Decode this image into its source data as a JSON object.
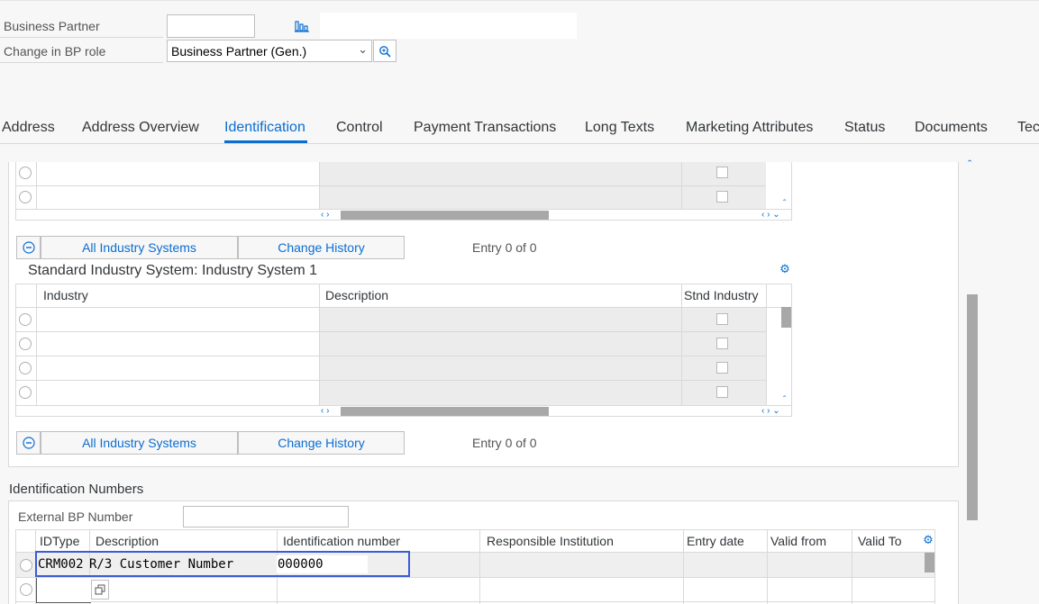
{
  "header": {
    "bp_label": "Business Partner",
    "bp_value": "",
    "bp_desc": "",
    "role_label": "Change in BP role",
    "role_value": "Business Partner (Gen.)"
  },
  "tabs": [
    {
      "label": "Address"
    },
    {
      "label": "Address Overview"
    },
    {
      "label": "Identification"
    },
    {
      "label": "Control"
    },
    {
      "label": "Payment Transactions"
    },
    {
      "label": "Long Texts"
    },
    {
      "label": "Marketing Attributes"
    },
    {
      "label": "Status"
    },
    {
      "label": "Documents"
    },
    {
      "label": "Tec"
    }
  ],
  "toolbar1": {
    "all_industry": "All Industry Systems",
    "change_history": "Change History",
    "entry": "Entry 0 of 0"
  },
  "industry_table": {
    "title": "Standard Industry System: Industry System 1",
    "columns": [
      "Industry",
      "Description",
      "Stnd Industry"
    ]
  },
  "toolbar2": {
    "all_industry": "All Industry Systems",
    "change_history": "Change History",
    "entry": "Entry 0 of 0"
  },
  "id_numbers": {
    "title": "Identification Numbers",
    "external_label": "External BP Number",
    "external_value": "",
    "columns": [
      "IDType",
      "Description",
      "Identification number",
      "Responsible Institution",
      "Entry date",
      "Valid from",
      "Valid To"
    ],
    "row1": {
      "idtype": "CRM002",
      "description": "R/3 Customer Number",
      "id_number": "000000"
    }
  },
  "colors": {
    "accent": "#0a6ed1",
    "highlight_border": "#3c5bd6"
  }
}
